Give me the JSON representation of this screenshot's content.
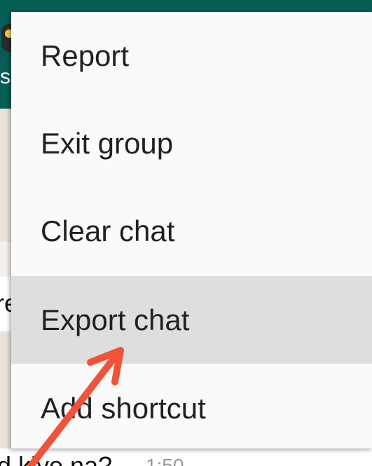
{
  "background_app": {
    "title_fragment": "s",
    "bubble_fragment": "re",
    "message_fragment": "d kiye na?",
    "time_fragment": "1:50"
  },
  "menu": {
    "items": [
      {
        "label": "Report",
        "highlighted": false
      },
      {
        "label": "Exit group",
        "highlighted": false
      },
      {
        "label": "Clear chat",
        "highlighted": false
      },
      {
        "label": "Export chat",
        "highlighted": true
      },
      {
        "label": "Add shortcut",
        "highlighted": false
      }
    ]
  },
  "colors": {
    "app_bar": "#075e54",
    "menu_background": "#fafafa",
    "highlight": "#dedede",
    "annotation_arrow": "#f0523a"
  },
  "annotation": {
    "type": "arrow",
    "points_to": "Export chat"
  }
}
